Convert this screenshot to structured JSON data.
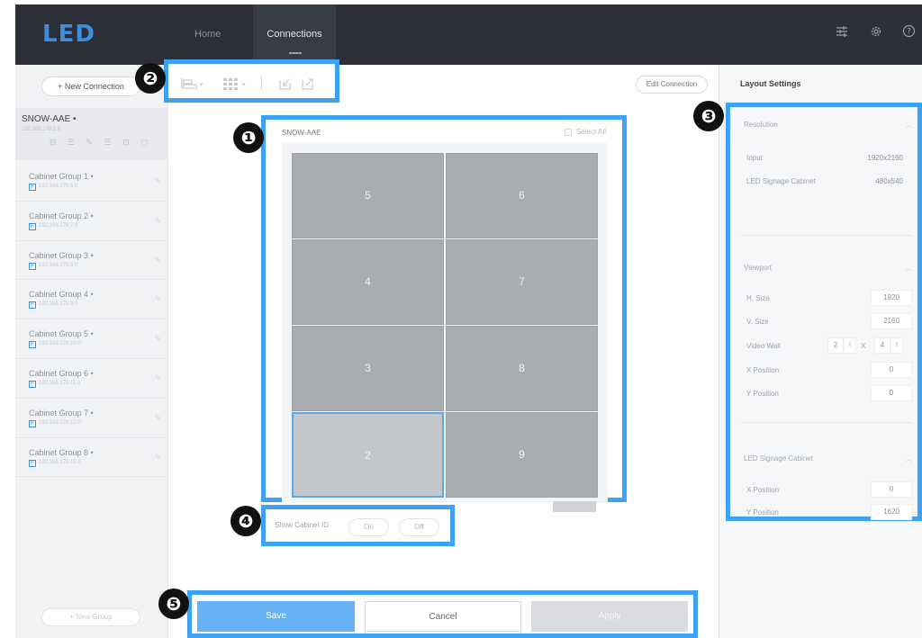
{
  "header": {
    "logo": "LED",
    "tabs": [
      {
        "label": "Home"
      },
      {
        "label": "Connections"
      }
    ],
    "icons": [
      "sliders-icon",
      "gear-icon",
      "help-icon"
    ]
  },
  "sidebar": {
    "new_connection": "+ New Connection",
    "connection": {
      "title": "SNOW-AAE •",
      "subtitle": "192.168.178.5 0"
    },
    "groups": [
      {
        "name": "Cabinet Group 1 •",
        "badge": "F",
        "sub": "192.168.178.6 0"
      },
      {
        "name": "Cabinet Group 2 •",
        "badge": "F",
        "sub": "192.168.178.7 0"
      },
      {
        "name": "Cabinet Group 3 •",
        "badge": "F",
        "sub": "192.168.178.8 0"
      },
      {
        "name": "Cabinet Group 4 •",
        "badge": "F",
        "sub": "192.168.178.9 0"
      },
      {
        "name": "Cabinet Group 5 •",
        "badge": "F",
        "sub": "192.168.178.10 0"
      },
      {
        "name": "Cabinet Group 6 •",
        "badge": "F",
        "sub": "192.168.178.11 0"
      },
      {
        "name": "Cabinet Group 7 •",
        "badge": "F",
        "sub": "192.168.178.12 0"
      },
      {
        "name": "Cabinet Group 8 •",
        "badge": "F",
        "sub": "192.168.178.13 0"
      }
    ],
    "new_group": "+ New Group"
  },
  "toolbar": {
    "edit_connection": "Edit Connection"
  },
  "canvas": {
    "title": "SNOW-AAE",
    "select_all": "Select All",
    "cabinets": [
      {
        "id": "5"
      },
      {
        "id": "6"
      },
      {
        "id": "4"
      },
      {
        "id": "7"
      },
      {
        "id": "3"
      },
      {
        "id": "8"
      },
      {
        "id": "2"
      },
      {
        "id": "9"
      }
    ],
    "selected_cabinet": "2"
  },
  "cabinet_id": {
    "label": "Show Cabinet ID",
    "on": "On",
    "off": "Off"
  },
  "actions": {
    "save": "Save",
    "cancel": "Cancel",
    "apply": "Apply"
  },
  "settings": {
    "title": "Layout Settings",
    "resolution": {
      "title": "Resolution",
      "input_label": "Input",
      "input_value": "1920x2160",
      "cabinet_label": "LED Signage Cabinet",
      "cabinet_value": "480x540"
    },
    "viewport": {
      "title": "Viewport",
      "h_size_label": "H. Size",
      "h_size": "1920",
      "v_size_label": "V. Size",
      "v_size": "2160",
      "video_wall_label": "Video Wall",
      "video_wall_cols": "2",
      "video_wall_x": "X",
      "video_wall_rows": "4",
      "x_pos_label": "X Position",
      "x_pos": "0",
      "y_pos_label": "Y Position",
      "y_pos": "0"
    },
    "cabinet": {
      "title": "LED Signage Cabinet",
      "x_pos_label": "X Position",
      "x_pos": "0",
      "y_pos_label": "Y Position",
      "y_pos": "1620"
    }
  },
  "callouts": [
    "❶",
    "❷",
    "❸",
    "❹",
    "❺"
  ],
  "colors": {
    "accent": "#3da2f3",
    "header_bg": "#2d3038",
    "cabinet": "#a9acb0",
    "save": "#66b2f5"
  }
}
